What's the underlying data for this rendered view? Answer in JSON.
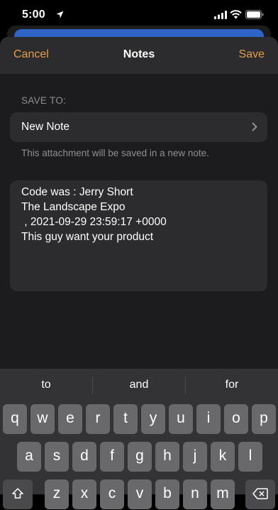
{
  "status": {
    "time": "5:00"
  },
  "nav": {
    "cancel": "Cancel",
    "title": "Notes",
    "save": "Save"
  },
  "form": {
    "section_label": "SAVE TO:",
    "destination": "New Note",
    "hint": "This attachment will be saved in a new note."
  },
  "editor": {
    "lines": [
      "Code was : Jerry Short",
      "The Landscape Expo",
      " , 2021-09-29 23:59:17 +0000",
      "This guy want your product"
    ]
  },
  "keyboard": {
    "suggestions": [
      "to",
      "and",
      "for"
    ],
    "row1": [
      "q",
      "w",
      "e",
      "r",
      "t",
      "y",
      "u",
      "i",
      "o",
      "p"
    ],
    "row2": [
      "a",
      "s",
      "d",
      "f",
      "g",
      "h",
      "j",
      "k",
      "l"
    ],
    "row3": [
      "z",
      "x",
      "c",
      "v",
      "b",
      "n",
      "m"
    ]
  },
  "colors": {
    "accent": "#e39d4b",
    "sheet": "#1c1c1e",
    "field": "#2c2c2e"
  }
}
